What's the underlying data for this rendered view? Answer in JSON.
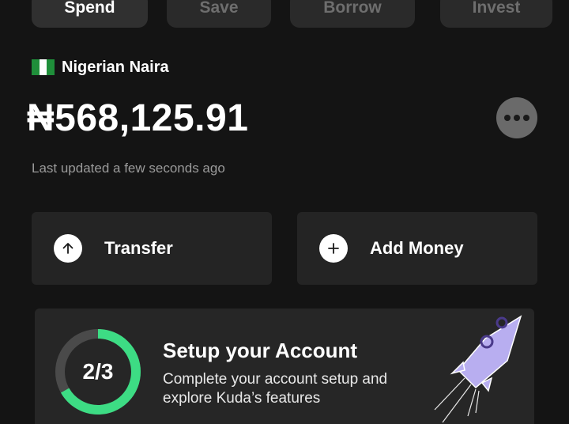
{
  "tabs": [
    {
      "label": "Spend",
      "active": true
    },
    {
      "label": "Save",
      "active": false
    },
    {
      "label": "Borrow",
      "active": false
    },
    {
      "label": "Invest",
      "active": false
    }
  ],
  "account": {
    "flag": "nigeria-flag-icon",
    "currency_name": "Nigerian Naira",
    "balance": "₦568,125.91",
    "last_updated": "Last updated a few seconds ago"
  },
  "actions": [
    {
      "label": "Transfer",
      "icon": "arrow-up-icon"
    },
    {
      "label": "Add Money",
      "icon": "plus-icon"
    }
  ],
  "setup": {
    "progress_label": "2/3",
    "progress_fraction": 0.667,
    "title": "Setup your Account",
    "description": "Complete your account setup and explore Kuda’s features"
  },
  "colors": {
    "background": "#141414",
    "card": "#242424",
    "progress": "#3ddc84",
    "progress_track": "#4a4a4a",
    "rocket": "#b8aef0"
  }
}
